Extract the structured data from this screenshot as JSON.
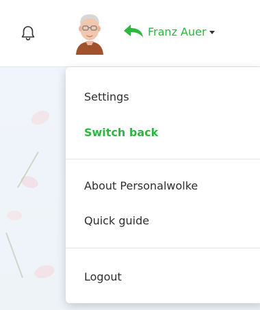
{
  "header": {
    "user_name": "Franz Auer",
    "icons": {
      "notifications": "bell-icon",
      "avatar": "avatar",
      "switch_back": "reply-arrow-icon",
      "dropdown": "caret-down-icon"
    },
    "accent_color": "#2db83d"
  },
  "menu": {
    "settings_label": "Settings",
    "switch_back_label": "Switch back",
    "about_label": "About Personalwolke",
    "quick_guide_label": "Quick guide",
    "logout_label": "Logout"
  }
}
